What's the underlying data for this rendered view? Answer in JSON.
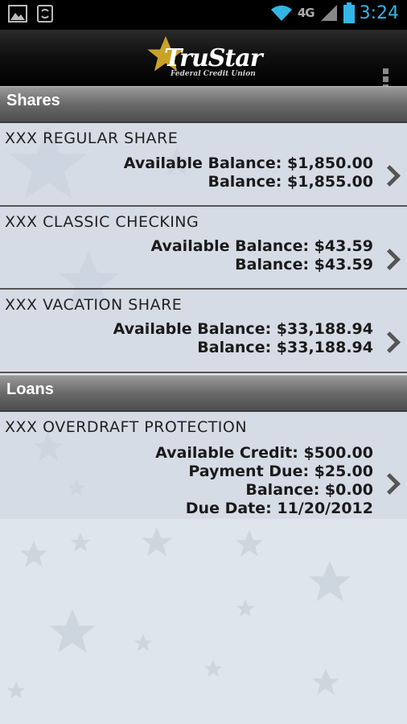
{
  "status_bar": {
    "time": "3:24",
    "network": "4G",
    "icons": [
      "gallery-icon",
      "sync-icon",
      "wifi-icon",
      "signal-icon",
      "battery-icon"
    ]
  },
  "header": {
    "brand_name": "TruStar",
    "brand_subtitle": "Federal Credit Union",
    "menu_icon": "overflow-menu-icon"
  },
  "shares": {
    "title": "Shares",
    "accounts": [
      {
        "name": "XXX  REGULAR SHARE",
        "lines": [
          "Available Balance: $1,850.00",
          "Balance: $1,855.00"
        ]
      },
      {
        "name": "XXX  CLASSIC CHECKING",
        "lines": [
          "Available Balance: $43.59",
          "Balance: $43.59"
        ]
      },
      {
        "name": "XXX  VACATION SHARE",
        "lines": [
          "Available Balance: $33,188.94",
          "Balance: $33,188.94"
        ]
      }
    ]
  },
  "loans": {
    "title": "Loans",
    "accounts": [
      {
        "name": "XXX OVERDRAFT PROTECTION",
        "lines": [
          "Available Credit: $500.00",
          "Payment Due: $25.00",
          "Balance: $0.00",
          "Due Date: 11/20/2012"
        ]
      }
    ]
  },
  "colors": {
    "accent": "#33b5e5",
    "background": "#dfe5ec",
    "logo_star": "#c9a227"
  }
}
